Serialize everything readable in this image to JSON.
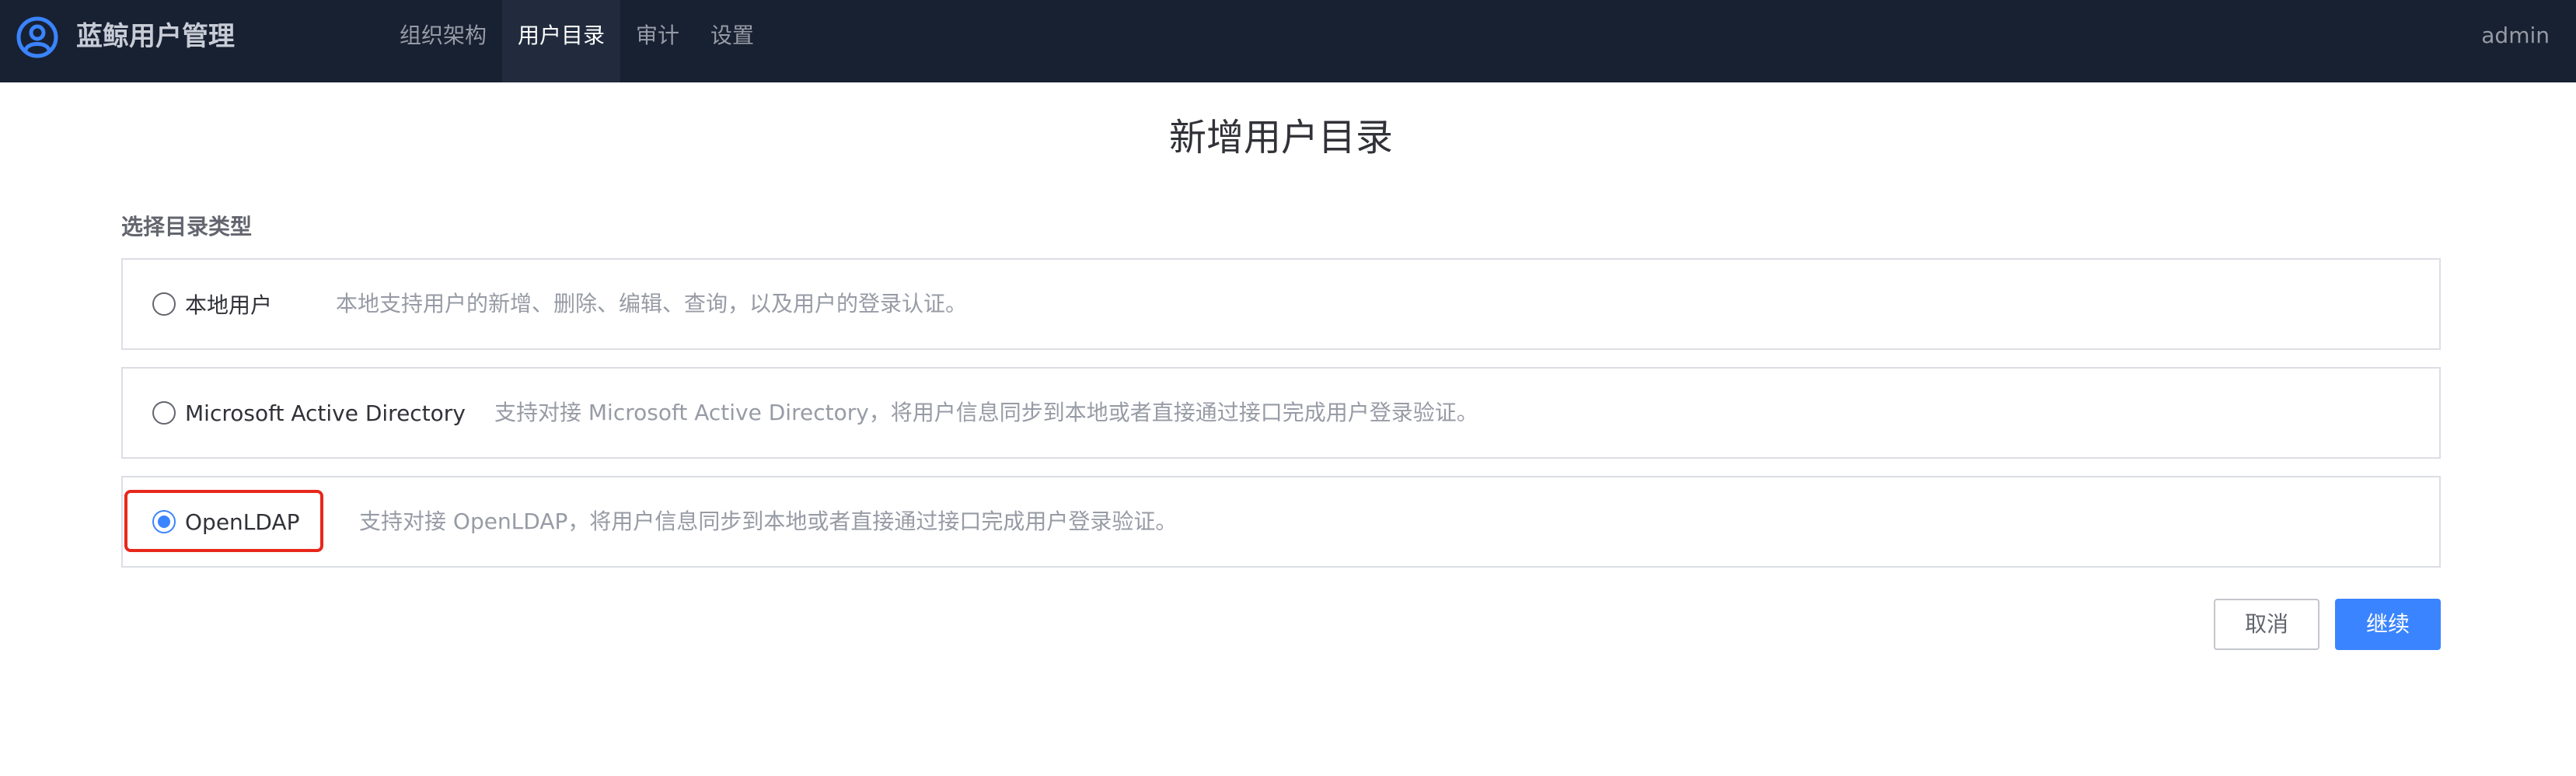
{
  "header": {
    "app_title": "蓝鲸用户管理",
    "logo_icon": "user-circle-icon",
    "nav": [
      {
        "label": "组织架构",
        "active": false
      },
      {
        "label": "用户目录",
        "active": true
      },
      {
        "label": "审计",
        "active": false
      },
      {
        "label": "设置",
        "active": false
      }
    ],
    "user": "admin"
  },
  "main": {
    "title": "新增用户目录",
    "section_label": "选择目录类型",
    "options": [
      {
        "label": "本地用户",
        "description": "本地支持用户的新增、删除、编辑、查询，以及用户的登录认证。",
        "selected": false
      },
      {
        "label": "Microsoft Active Directory",
        "description": "支持对接 Microsoft Active Directory，将用户信息同步到本地或者直接通过接口完成用户登录验证。",
        "selected": false
      },
      {
        "label": "OpenLDAP",
        "description": "支持对接 OpenLDAP，将用户信息同步到本地或者直接通过接口完成用户登录验证。",
        "selected": true
      }
    ],
    "buttons": {
      "cancel": "取消",
      "continue": "继续"
    }
  },
  "colors": {
    "header_bg": "#182132",
    "primary": "#3a84ff",
    "highlight": "#e8271b",
    "border": "#dcdee5"
  }
}
